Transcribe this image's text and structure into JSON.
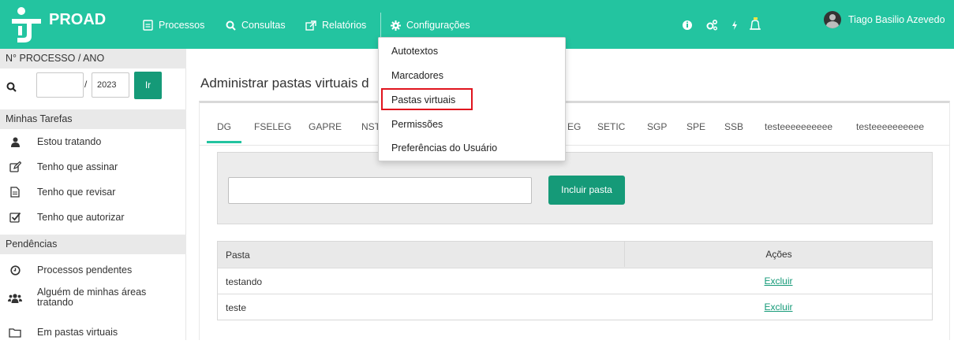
{
  "navbar": {
    "brand": "PROAD",
    "items": [
      {
        "label": "Processos",
        "icon": "file-icon"
      },
      {
        "label": "Consultas",
        "icon": "search-icon"
      },
      {
        "label": "Relatórios",
        "icon": "external-link-icon"
      },
      {
        "label": "Configurações",
        "icon": "gear-icon"
      }
    ],
    "user_name": "Tiago Basilio Azevedo",
    "accent_color": "#23c4a0"
  },
  "sidebar": {
    "process_header": "N° PROCESSO / ANO",
    "number_value": "",
    "year_value": "2023",
    "go_label": "Ir",
    "tasks_header": "Minhas Tarefas",
    "tasks": [
      {
        "label": "Estou tratando",
        "icon": "user-icon"
      },
      {
        "label": "Tenho que assinar",
        "icon": "edit-icon"
      },
      {
        "label": "Tenho que revisar",
        "icon": "document-icon"
      },
      {
        "label": "Tenho que autorizar",
        "icon": "check-square-icon"
      }
    ],
    "pending_header": "Pendências",
    "pending": [
      {
        "label": "Processos pendentes",
        "icon": "clock-icon"
      },
      {
        "label": "Alguém de minhas áreas tratando",
        "icon": "users-icon"
      },
      {
        "label": "Em pastas virtuais",
        "icon": "folder-icon"
      }
    ]
  },
  "main": {
    "title": "Administrar pastas virtuais d",
    "tabs": [
      "DG",
      "FSELEG",
      "GAPRE",
      "NST",
      "EG",
      "SETIC",
      "SGP",
      "SPE",
      "SSB",
      "testeeeeeeeeee",
      "testeeeeeeeeee"
    ],
    "active_tab": "DG",
    "pasta_input_value": "",
    "include_button": "Incluir pasta",
    "table": {
      "headers": [
        "Pasta",
        "Ações"
      ],
      "rows": [
        {
          "pasta": "testando",
          "acao": "Excluir"
        },
        {
          "pasta": "teste",
          "acao": "Excluir"
        }
      ]
    }
  },
  "dropdown": {
    "items": [
      "Autotextos",
      "Marcadores",
      "Pastas virtuais",
      "Permissões",
      "Preferências do Usuário"
    ],
    "highlighted": "Pastas virtuais"
  }
}
